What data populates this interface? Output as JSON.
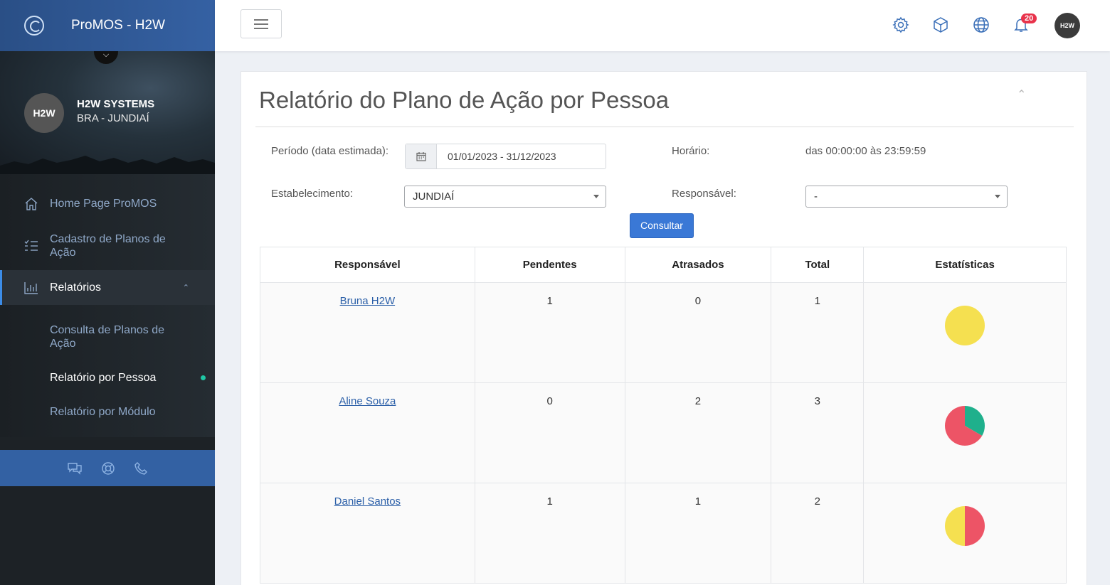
{
  "app": {
    "title": "ProMOS - H2W"
  },
  "profile": {
    "avatar_text": "H2W",
    "company": "H2W SYSTEMS",
    "location": "BRA - JUNDIAÍ"
  },
  "sidebar": {
    "items": [
      {
        "label": "Home Page ProMOS",
        "icon": "home-icon"
      },
      {
        "label": "Cadastro de Planos de Ação",
        "icon": "list-check-icon"
      },
      {
        "label": "Relatórios",
        "icon": "bar-chart-icon"
      }
    ],
    "subitems": [
      {
        "label": "Consulta de Planos de Ação"
      },
      {
        "label": "Relatório por Pessoa"
      },
      {
        "label": "Relatório por Módulo"
      }
    ],
    "footer_icons": [
      "chat-icon",
      "lifebuoy-icon",
      "phone-icon"
    ]
  },
  "header": {
    "icons": [
      "gear-icon",
      "cube-icon",
      "globe-icon",
      "bell-icon"
    ],
    "notification_count": "20",
    "user_avatar_text": "H2W"
  },
  "page": {
    "title": "Relatório do Plano de Ação por Pessoa",
    "filters": {
      "periodo_label": "Período (data estimada):",
      "periodo_value": "01/01/2023 - 31/12/2023",
      "horario_label": "Horário:",
      "horario_value": "das 00:00:00 às 23:59:59",
      "estabelecimento_label": "Estabelecimento:",
      "estabelecimento_value": "JUNDIAÍ",
      "responsavel_label": "Responsável:",
      "responsavel_value": "-"
    },
    "consultar_label": "Consultar"
  },
  "table": {
    "headers": [
      "Responsável",
      "Pendentes",
      "Atrasados",
      "Total",
      "Estatísticas"
    ],
    "rows": [
      {
        "responsavel": "Bruna H2W",
        "pendentes": "1",
        "atrasados": "0",
        "total": "1"
      },
      {
        "responsavel": "Aline Souza",
        "pendentes": "0",
        "atrasados": "2",
        "total": "3"
      },
      {
        "responsavel": "Daniel Santos",
        "pendentes": "1",
        "atrasados": "1",
        "total": "2"
      }
    ]
  },
  "colors": {
    "pendentes": "#f5e050",
    "atrasados": "#ed5466",
    "concluidos": "#1fb08c",
    "accent": "#3a78d6"
  },
  "chart_data": [
    {
      "type": "pie",
      "slices": [
        {
          "value": 1,
          "color": "#f5e050"
        }
      ]
    },
    {
      "type": "pie",
      "slices": [
        {
          "value": 1,
          "color": "#1fb08c"
        },
        {
          "value": 2,
          "color": "#ed5466"
        }
      ]
    },
    {
      "type": "pie",
      "slices": [
        {
          "value": 1,
          "color": "#ed5466"
        },
        {
          "value": 1,
          "color": "#f5e050"
        }
      ]
    }
  ]
}
